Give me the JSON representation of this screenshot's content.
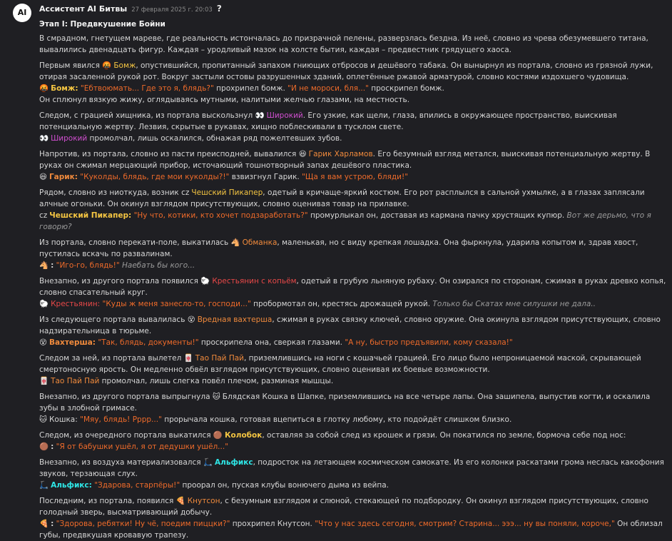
{
  "author": "Ассистент AI Битвы",
  "avatar_text": "AI",
  "time": "27 февраля 2025 г. 20:03",
  "help_icon": "?",
  "stage": "Этап I: Предвкушение Бойни",
  "intro": "В смрадном, гнетущем мареве, где реальность истончалась до призрачной пелены, разверзлась бездна. Из неё, словно из чрева обезумевшего титана, вывалились двенадцать фигур. Каждая – уродливый мазок на холсте бытия, каждая – предвестник грядущего хаоса.",
  "p1": {
    "a": "Первым явился ",
    "emoji": "🤬",
    "name": "Бомж",
    "b": ", опустившийся, пропитанный запахом гниющих отбросов и дешёвого табака. Он вынырнул из портала, словно из грязной лужи, отирая засаленной рукой рот. Вокруг застыли остовы разрушенных зданий, оплетённые ржавой арматурой, словно костями издохшего чудовища.",
    "line_emoji": "🤬",
    "line_name": "Бомж:",
    "q1": "\"Ебтвоюмать... Где это я, блядь?\"",
    "c": " прохрипел бомж. ",
    "q2": "\"И не мороси, бля...\"",
    "d": " проскрипел бомж.",
    "e": "Он сплюнул вязкую жижу, оглядываясь мутными, налитыми желчью глазами, на местность."
  },
  "p2": {
    "a": "Следом, с грацией хищника, из портала выскользнул ",
    "emoji": "👀",
    "name": "Широкий",
    "b": ". Его узкие, как щели, глаза, впились в окружающее пространство, выискивая потенциальную жертву. Лезвия, скрытые в рукавах, хищно поблескивали в тусклом свете.",
    "line_emoji": "👀",
    "line_name": "Широкий",
    "c": " промолчал, лишь оскалился, обнажая ряд пожелтевших зубов."
  },
  "p3": {
    "a": "Напротив, из портала, словно из пасти преисподней, вывалился ",
    "emoji": "😆",
    "name": "Гарик Харламов",
    "b": ". Его безумный взгляд метался, выискивая потенциальную жертву. В руках он сжимал мерцающий прибор, источающий тошнотворный запах дешёвого пластика.",
    "line_emoji": "😆",
    "line_name": "Гарик:",
    "q1": "\"Куколды, блядь, где мои куколды?!\"",
    "c": " взвизгнул Гарик. ",
    "q2": "\"Ща я вам устрою, бляди!\""
  },
  "p4": {
    "a": "Рядом, словно из ниоткуда, возник ",
    "emoji": "cz",
    "name": "Чешский Пикапер",
    "b": ", одетый в кричаще-яркий костюм. Его рот расплылся в сальной ухмылке, а в глазах заплясали алчные огоньки. Он окинул взглядом присутствующих, словно оценивая товар на прилавке.",
    "line_emoji": "cz",
    "line_name": "Чешский Пикапер:",
    "q1": "\"Ну что, котики, кто хочет подзаработать?\"",
    "c": " промурлыкал он, доставая из кармана пачку хрустящих купюр. ",
    "it": "Вот же дерьмо, что я говорю?"
  },
  "p5": {
    "a": "Из портала, словно перекати-поле, выкатилась ",
    "emoji": "🐴",
    "name": "Обманка",
    "b": ", маленькая, но с виду крепкая лошадка. Она фыркнула, ударила копытом и, здрав хвост, пустилась вскачь по развалинам.",
    "line_emoji": "🐴",
    "line_name": ":",
    "q1": "\"Иго-го, блядь!\"",
    "it": "Наебать бы кого..."
  },
  "p6": {
    "a": "Внезапно, из другого портала появился ",
    "emoji": "🐑",
    "name": "Крестьянин с копьём",
    "b": ", одетый в грубую льняную рубаху. Он озирался по сторонам, сжимая в руках древко копья, словно спасательный круг.",
    "line_emoji": "🐑",
    "line_name": "Крестьянин:",
    "q1": "\"Куды ж меня занесло-то, господи...\"",
    "c": " пробормотал он, крестясь дрожащей рукой. ",
    "it": "Только бы Скатах мне силушки не дала.."
  },
  "p7": {
    "a": "Из следующего портала вывалилась ",
    "emoji": "😵",
    "name": "Вредная вахтерша",
    "b": ", сжимая в руках связку ключей, словно оружие. Она окинула взглядом присутствующих, словно надзирательница в тюрьме.",
    "line_emoji": "😵",
    "line_name": "Вахтерша:",
    "q1": "\"Так, блядь, документы!\"",
    "c": " проскрипела она, сверкая глазами. ",
    "q2": "\"А ну, быстро предъявили, кому сказала!\""
  },
  "p8": {
    "a": "Следом за ней, из портала вылетел ",
    "emoji": "🀄",
    "name": "Тао Пай Пай",
    "b": ", приземлившись на ноги с кошачьей грацией. Его лицо было непроницаемой маской, скрывающей смертоносную ярость. Он медленно обвёл взглядом присутствующих, словно оценивая их боевые возможности.",
    "line_emoji": "🀄",
    "line_name": "Тао Пай Пай",
    "c": " промолчал, лишь слегка повёл плечом, разминая мышцы."
  },
  "p9": {
    "a": "Внезапно, из другого портала выпрыгнула ",
    "emoji": "🐱",
    "name": "Блядская Кошка в Шапке",
    "b": ", приземлившись на все четыре лапы. Она зашипела, выпустив когти, и оскалила зубы в злобной гримасе.",
    "line_emoji": "🐱",
    "line_name": "Кошка:",
    "q1": "\"Мяу, блядь! Рррр...\"",
    "c": " прорычала кошка, готовая вцепиться в глотку любому, кто подойдёт слишком близко."
  },
  "p10": {
    "a": "Следом, из очередного портала выкатился ",
    "emoji": "🟤",
    "name": "Колобок",
    "b": ", оставляя за собой след из крошек и грязи. Он покатился по земле, бормоча себе под нос:",
    "line_emoji": "🟤",
    "line_name": ":",
    "q1": "\"Я от бабушки ушёл, я от дедушки ушёл...\""
  },
  "p11": {
    "a": "Внезапно, из воздуха материализовался ",
    "emoji": "🛴",
    "name": "Альфикс",
    "b": ", подросток на летающем космическом самокате. Из его колонки раскатами грома неслась какофония звуков, терзающая слух.",
    "line_emoji": "🛴",
    "line_name": "Альфикс:",
    "q1": "\"Здарова, старпёры!\"",
    "c": " проорал он, пуская клубы вонючего дыма из вейпа."
  },
  "p12": {
    "a": "Последним, из портала, появился ",
    "emoji": "🍕",
    "name": "Кнутсон",
    "b": ", с безумным взглядом и слюной, стекающей по подбородку. Он окинул взглядом присутствующих, словно голодный зверь, высматривающий добычу.",
    "line_emoji": "🍕",
    "line_name": ":",
    "q1": "\"Здорова, ребятки! Ну чё, поедим пиццки?\"",
    "c": " прохрипел Кнутсон. ",
    "q2": "\"Что у нас здесь сегодня, смотрим? Старина... эээ... ну вы поняли, короче,\"",
    "d": " Он облизал губы, предвкушая кровавую трапезу."
  }
}
